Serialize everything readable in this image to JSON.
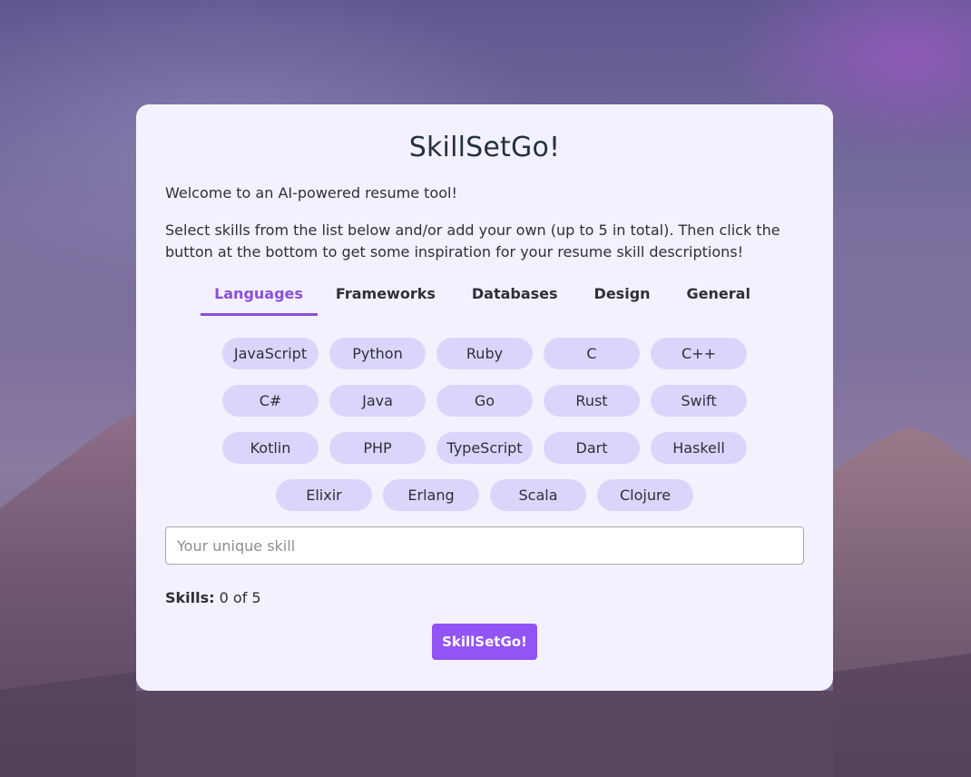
{
  "app": {
    "title": "SkillSetGo!",
    "welcome": "Welcome to an AI-powered resume tool!",
    "instructions": "Select skills from the list below and/or add your own (up to 5 in total). Then click the button at the bottom to get some inspiration for your resume skill descriptions!"
  },
  "tabs": [
    {
      "label": "Languages",
      "active": true
    },
    {
      "label": "Frameworks",
      "active": false
    },
    {
      "label": "Databases",
      "active": false
    },
    {
      "label": "Design",
      "active": false
    },
    {
      "label": "General",
      "active": false
    }
  ],
  "skills": {
    "rows": [
      [
        "JavaScript",
        "Python",
        "Ruby",
        "C",
        "C++"
      ],
      [
        "C#",
        "Java",
        "Go",
        "Rust",
        "Swift"
      ],
      [
        "Kotlin",
        "PHP",
        "TypeScript",
        "Dart",
        "Haskell"
      ],
      [
        "Elixir",
        "Erlang",
        "Scala",
        "Clojure"
      ]
    ]
  },
  "input": {
    "placeholder": "Your unique skill",
    "value": ""
  },
  "counter": {
    "label": "Skills:",
    "value": "0 of 5"
  },
  "submit": {
    "label": "SkillSetGo!"
  },
  "colors": {
    "accent": "#8a4fdf",
    "button": "#9254f5",
    "chip": "#dad6fb",
    "card": "#f3f1fe"
  }
}
